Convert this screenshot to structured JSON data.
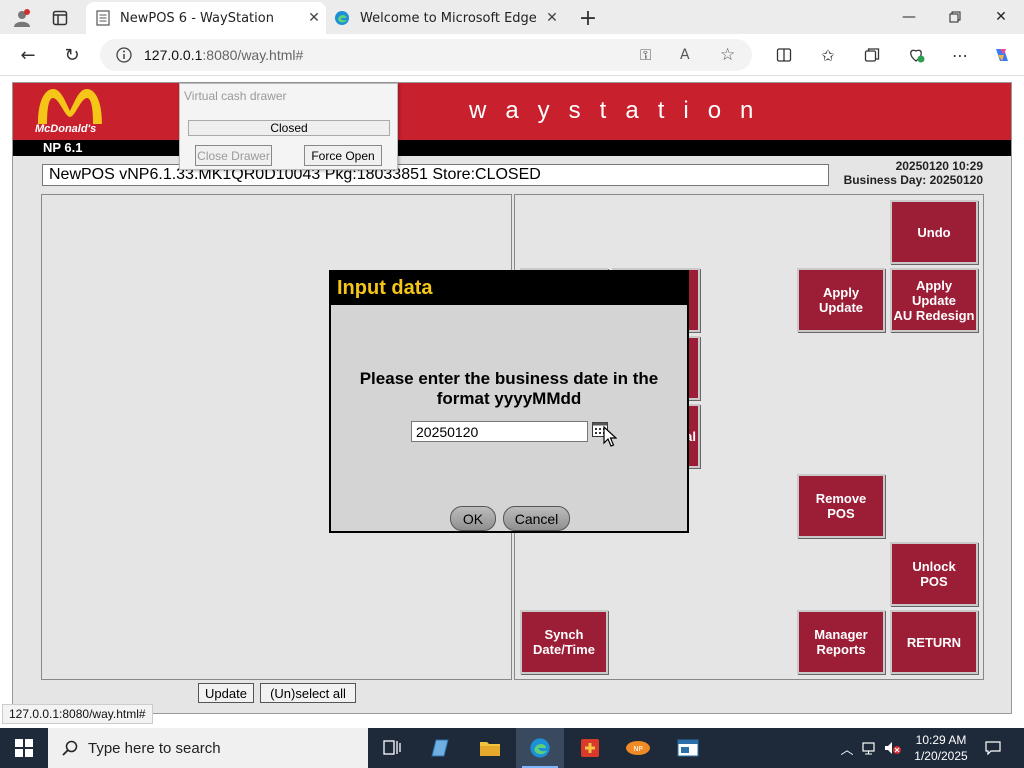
{
  "browser": {
    "tabs": [
      {
        "title": "NewPOS 6 - WayStation",
        "active": true
      },
      {
        "title": "Welcome to Microsoft Edge",
        "active": false
      }
    ],
    "url_host": "127.0.0.1",
    "url_rest": ":8080/way.html#",
    "hover_url": "127.0.0.1:8080/way.html#"
  },
  "page": {
    "logo_word": "McDonald's",
    "title": "waystation",
    "version": "NP 6.1",
    "status_line": "NewPOS vNP6.1.33.MK1QR0D10043 Pkg:18033851 Store:CLOSED",
    "datetime": "20250120 10:29",
    "business_day": "Business Day: 20250120",
    "update_label": "Update",
    "select_all_label": "(Un)select all",
    "buttons": {
      "undo": "Undo",
      "apply_update": "Apply\nUpdate",
      "apply_update_au": "Apply\nUpdate\nAU Redesign",
      "remove_pos": "Remove\nPOS",
      "unlock_pos": "Unlock\nPOS",
      "synch": "Synch\nDate/Time",
      "manager_reports": "Manager\nReports",
      "return": "RETURN",
      "hidden_partial_1": "al",
      "hidden_partial_2": ""
    },
    "accent_color": "#c8202d",
    "button_color": "#9b1d36"
  },
  "drawer": {
    "title": "Virtual cash drawer",
    "state": "Closed",
    "close_label": "Close Drawer",
    "open_label": "Force Open"
  },
  "modal": {
    "title": "Input data",
    "message": "Please enter the business date in the\nformat yyyyMMdd",
    "input_value": "20250120",
    "ok_label": "OK",
    "cancel_label": "Cancel",
    "title_color": "#f5c518"
  },
  "taskbar": {
    "search_placeholder": "Type here to search",
    "time": "10:29 AM",
    "date": "1/20/2025"
  }
}
